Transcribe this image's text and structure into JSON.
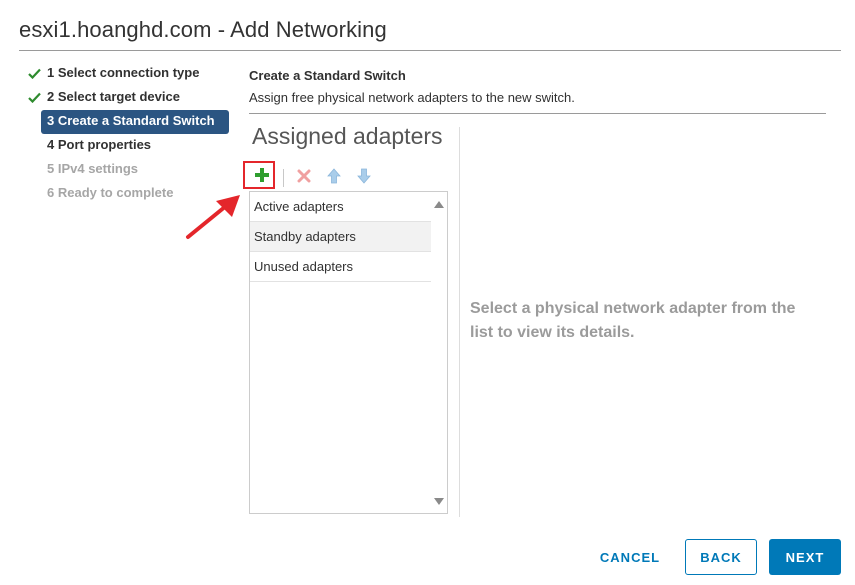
{
  "window": {
    "title": "esxi1.hoanghd.com - Add Networking"
  },
  "steps": [
    {
      "label": "1 Select connection type",
      "state": "done"
    },
    {
      "label": "2 Select target device",
      "state": "done"
    },
    {
      "label": "3 Create a Standard Switch",
      "state": "active"
    },
    {
      "label": "4 Port properties",
      "state": "pending"
    },
    {
      "label": "5 IPv4 settings",
      "state": "disabled"
    },
    {
      "label": "6 Ready to complete",
      "state": "disabled"
    }
  ],
  "section": {
    "title": "Create a Standard Switch",
    "description": "Assign free physical network adapters to the new switch."
  },
  "assigned": {
    "title": "Assigned adapters",
    "toolbar": {
      "add_icon": "plus-icon",
      "remove_icon": "close-icon",
      "up_icon": "arrow-up-icon",
      "down_icon": "arrow-down-icon"
    },
    "items": [
      {
        "label": "Active adapters"
      },
      {
        "label": "Standby adapters"
      },
      {
        "label": "Unused adapters"
      }
    ]
  },
  "details": {
    "hint": "Select a physical network adapter from the list to view its details."
  },
  "footer": {
    "cancel_label": "CANCEL",
    "back_label": "BACK",
    "next_label": "NEXT"
  },
  "colors": {
    "accent": "#0079b8",
    "active_step": "#2b5582",
    "check": "#2e8b2e",
    "add": "#2f9e2f",
    "annotation": "#e4262b"
  }
}
